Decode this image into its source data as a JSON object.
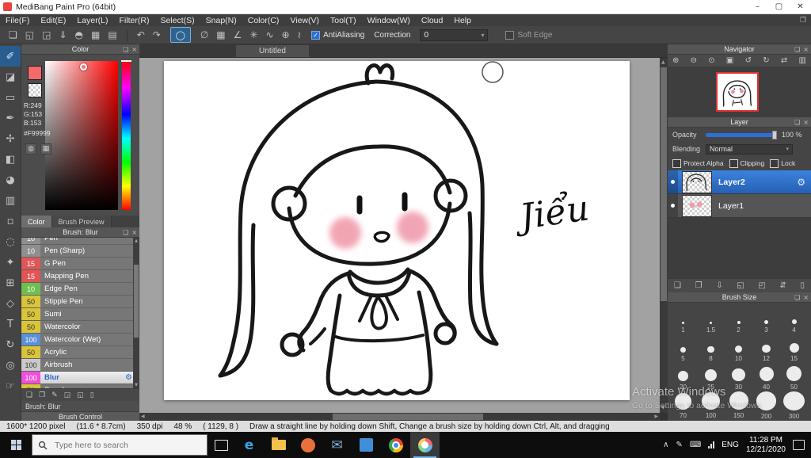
{
  "glyphs": {
    "popout": "❏",
    "close": "×",
    "restore": "❐",
    "caret": "▾",
    "check": "✓",
    "gear": "⚙",
    "up": "▲",
    "down": "▼",
    "left": "◀",
    "right": "▶"
  },
  "title_bar": {
    "title": "MediBang Paint Pro (64bit)",
    "controls": [
      {
        "name": "minimize",
        "glyph": "–"
      },
      {
        "name": "maximize",
        "glyph": "▢"
      },
      {
        "name": "close",
        "glyph": "✕"
      }
    ]
  },
  "menu_bar": {
    "items": [
      "File(F)",
      "Edit(E)",
      "Layer(L)",
      "Filter(R)",
      "Select(S)",
      "Snap(N)",
      "Color(C)",
      "View(V)",
      "Tool(T)",
      "Window(W)",
      "Cloud",
      "Help"
    ]
  },
  "toolbar": {
    "file_icons": [
      {
        "name": "new-canvas-icon",
        "glyph": "❏"
      },
      {
        "name": "open-icon",
        "glyph": "◱"
      },
      {
        "name": "save-icon",
        "glyph": "◲"
      },
      {
        "name": "export-icon",
        "glyph": "⇓"
      },
      {
        "name": "comment-icon",
        "glyph": "◓"
      },
      {
        "name": "grid-icon",
        "glyph": "▦"
      },
      {
        "name": "material-icon",
        "glyph": "▤"
      }
    ],
    "undo_glyph": "↶",
    "redo_glyph": "↷",
    "active_tool_glyph": "◯",
    "snap_icons": [
      {
        "name": "snap-off-icon",
        "glyph": "∅"
      },
      {
        "name": "snap-grid-icon",
        "glyph": "▦"
      },
      {
        "name": "snap-angle-icon",
        "glyph": "∠"
      },
      {
        "name": "snap-radial-icon",
        "glyph": "✳"
      },
      {
        "name": "snap-curve-icon",
        "glyph": "∿"
      },
      {
        "name": "snap-circle-icon",
        "glyph": "⊕"
      },
      {
        "name": "snap-free-icon",
        "glyph": "≀"
      }
    ],
    "antialiasing_label": "AntiAliasing",
    "correction_label": "Correction",
    "correction_value": "0",
    "soft_edge_label": "Soft Edge"
  },
  "tool_strip": [
    {
      "name": "brush-tool",
      "glyph": "✐",
      "selected": true
    },
    {
      "name": "eraser-tool",
      "glyph": "◪"
    },
    {
      "name": "marquee-tool",
      "glyph": "▭"
    },
    {
      "name": "pen-tool",
      "glyph": "✒"
    },
    {
      "name": "move-tool",
      "glyph": "✢"
    },
    {
      "name": "fill-tool",
      "glyph": "◧"
    },
    {
      "name": "bucket-tool",
      "glyph": "◕"
    },
    {
      "name": "gradient-tool",
      "glyph": "▥"
    },
    {
      "name": "select-tool",
      "glyph": "▫"
    },
    {
      "name": "lasso-tool",
      "glyph": "◌"
    },
    {
      "name": "wand-tool",
      "glyph": "✦"
    },
    {
      "name": "divide-tool",
      "glyph": "⊞"
    },
    {
      "name": "shape-tool",
      "glyph": "◇"
    },
    {
      "name": "text-tool",
      "glyph": "T"
    },
    {
      "name": "rotate-tool",
      "glyph": "↻"
    },
    {
      "name": "eyedropper-tool",
      "glyph": "◎"
    },
    {
      "name": "hand-tool",
      "glyph": "☞"
    }
  ],
  "color_panel": {
    "title": "Color",
    "r": "R:249",
    "g": "G:153",
    "b": "B:153",
    "hex": "#F99999",
    "wheel_icon": "◍",
    "palette_icon": "▦",
    "tabs": [
      {
        "label": "Color",
        "active": true
      },
      {
        "label": "Brush Preview",
        "active": false
      }
    ]
  },
  "brush_panel": {
    "title": "Brush: Blur",
    "brushes": [
      {
        "size": "10",
        "name": "Pen",
        "chip": "#8f8f8f",
        "chip_text": "#ffffff"
      },
      {
        "size": "10",
        "name": "Pen (Sharp)",
        "chip": "#8f8f8f",
        "chip_text": "#ffffff"
      },
      {
        "size": "15",
        "name": "G Pen",
        "chip": "#e05555",
        "chip_text": "#ffffff"
      },
      {
        "size": "15",
        "name": "Mapping Pen",
        "chip": "#e05555",
        "chip_text": "#ffffff"
      },
      {
        "size": "10",
        "name": "Edge Pen",
        "chip": "#6fbf4f",
        "chip_text": "#ffffff"
      },
      {
        "size": "50",
        "name": "Stipple Pen",
        "chip": "#d9c43a",
        "chip_text": "#333333"
      },
      {
        "size": "50",
        "name": "Sumi",
        "chip": "#d9c43a",
        "chip_text": "#333333"
      },
      {
        "size": "50",
        "name": "Watercolor",
        "chip": "#d9c43a",
        "chip_text": "#333333"
      },
      {
        "size": "100",
        "name": "Watercolor (Wet)",
        "chip": "#5b8fd8",
        "chip_text": "#ffffff"
      },
      {
        "size": "50",
        "name": "Acrylic",
        "chip": "#d9c43a",
        "chip_text": "#333333"
      },
      {
        "size": "100",
        "name": "Airbrush",
        "chip": "#c9c9c9",
        "chip_text": "#333333"
      },
      {
        "size": "100",
        "name": "Blur",
        "chip": "#f050d8",
        "chip_text": "#ffffff",
        "selected": true
      },
      {
        "size": "70",
        "name": "Smudge",
        "chip": "#d9c43a",
        "chip_text": "#333333"
      }
    ],
    "footer_icons": [
      {
        "name": "add-brush-icon",
        "glyph": "❏"
      },
      {
        "name": "duplicate-brush-icon",
        "glyph": "❐"
      },
      {
        "name": "edit-brush-icon",
        "glyph": "✎"
      },
      {
        "name": "import-brush-icon",
        "glyph": "◲"
      },
      {
        "name": "brush-folder-icon",
        "glyph": "◱"
      },
      {
        "name": "delete-brush-icon",
        "glyph": "▯"
      }
    ],
    "footer_label": "Brush: Blur",
    "control_tab": "Brush Control"
  },
  "canvas": {
    "tab": "Untitled",
    "signature": "Jiểu"
  },
  "navigator": {
    "title": "Navigator",
    "icons": [
      {
        "name": "zoom-in-icon",
        "glyph": "⊕"
      },
      {
        "name": "zoom-out-icon",
        "glyph": "⊖"
      },
      {
        "name": "zoom-actual-icon",
        "glyph": "⊙"
      },
      {
        "name": "fit-window-icon",
        "glyph": "▣"
      },
      {
        "name": "rotate-ccw-icon",
        "glyph": "↺"
      },
      {
        "name": "rotate-cw-icon",
        "glyph": "↻"
      },
      {
        "name": "flip-icon",
        "glyph": "⇄"
      },
      {
        "name": "spread-view-icon",
        "glyph": "▥"
      }
    ]
  },
  "layer_panel": {
    "title": "Layer",
    "opacity_label": "Opacity",
    "opacity_value": "100 %",
    "blending_label": "Blending",
    "blending_value": "Normal",
    "checkboxes": [
      "Protect Alpha",
      "Clipping",
      "Lock"
    ],
    "layers": [
      {
        "name": "Layer2",
        "selected": true,
        "thumb": "lineart"
      },
      {
        "name": "Layer1",
        "selected": false,
        "thumb": "pink"
      }
    ],
    "footer_icons": [
      {
        "name": "add-layer-icon",
        "glyph": "❏"
      },
      {
        "name": "duplicate-layer-icon",
        "glyph": "❐"
      },
      {
        "name": "merge-down-icon",
        "glyph": "⇩"
      },
      {
        "name": "add-folder-icon",
        "glyph": "◱"
      },
      {
        "name": "layer-folder-icon",
        "glyph": "◰"
      },
      {
        "name": "reorder-layer-icon",
        "glyph": "⇵"
      },
      {
        "name": "delete-layer-icon",
        "glyph": "▯"
      }
    ]
  },
  "brush_size_panel": {
    "title": "Brush Size",
    "sizes": [
      {
        "label": "1",
        "d": 3
      },
      {
        "label": "1.5",
        "d": 3.5
      },
      {
        "label": "2",
        "d": 4
      },
      {
        "label": "3",
        "d": 5
      },
      {
        "label": "4",
        "d": 6
      },
      {
        "label": "5",
        "d": 7
      },
      {
        "label": "8",
        "d": 8.5
      },
      {
        "label": "10",
        "d": 9.5
      },
      {
        "label": "12",
        "d": 10.5
      },
      {
        "label": "15",
        "d": 12
      },
      {
        "label": "20",
        "d": 13.5
      },
      {
        "label": "25",
        "d": 15
      },
      {
        "label": "30",
        "d": 16.5
      },
      {
        "label": "40",
        "d": 18
      },
      {
        "label": "50",
        "d": 19.5
      },
      {
        "label": "70",
        "d": 21
      },
      {
        "label": "100",
        "d": 22.5
      },
      {
        "label": "150",
        "d": 24
      },
      {
        "label": "200",
        "d": 25.5
      },
      {
        "label": "300",
        "d": 27
      }
    ]
  },
  "status_bar": {
    "fields": [
      "1600* 1200 pixel",
      "(11.6 * 8.7cm)",
      "350 dpi",
      "48 %",
      "( 1129, 8 )",
      "Draw a straight line by holding down Shift, Change a brush size by holding down Ctrl, Alt, and dragging"
    ]
  },
  "taskbar": {
    "search_placeholder": "Type here to search",
    "apps": [
      {
        "name": "edge",
        "kind": "glyph",
        "glyph": "e",
        "color": "#35a3e8"
      },
      {
        "name": "explorer",
        "kind": "folder"
      },
      {
        "name": "store",
        "kind": "circle",
        "color": "#e8703a"
      },
      {
        "name": "mail",
        "kind": "glyph",
        "glyph": "✉",
        "color": "#7fb2e0"
      },
      {
        "name": "photos",
        "kind": "square",
        "color": "#3f8fd6"
      },
      {
        "name": "chrome",
        "kind": "chrome"
      },
      {
        "name": "medibang",
        "kind": "medibang",
        "active": true
      }
    ],
    "tray": [
      {
        "name": "hidden-icons-icon",
        "glyph": "∧"
      },
      {
        "name": "pen-settings-icon",
        "glyph": "✎"
      },
      {
        "name": "touch-keyboard-icon",
        "glyph": "⌨"
      },
      {
        "name": "network-icon",
        "kind": "bars"
      }
    ],
    "lang": "ENG",
    "time": "11:28 PM",
    "date": "12/21/2020"
  },
  "watermark": {
    "line1": "Activate Windows",
    "line2": "Go to Settings to activate Windows."
  }
}
